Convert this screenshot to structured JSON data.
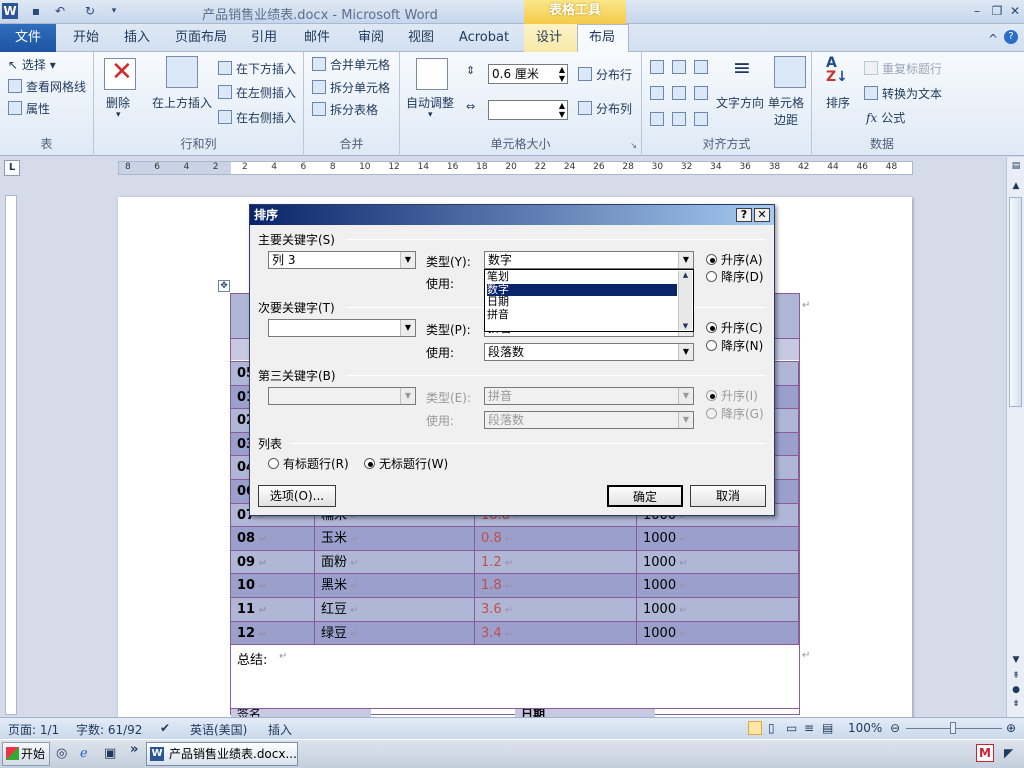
{
  "titlebar": {
    "title": "产品销售业绩表.docx - Microsoft Word",
    "context_group": "表格工具",
    "app_icon": "W"
  },
  "tabs": {
    "file": "文件",
    "items": [
      "开始",
      "插入",
      "页面布局",
      "引用",
      "邮件",
      "审阅",
      "视图",
      "Acrobat",
      "设计",
      "布局"
    ],
    "active": "布局"
  },
  "ribbon": {
    "table": {
      "label": "表",
      "select": "选择",
      "view_gridlines": "查看网格线",
      "properties": "属性"
    },
    "rows_cols": {
      "label": "行和列",
      "delete": "删除",
      "insert_above": "在上方插入",
      "insert_below": "在下方插入",
      "insert_left": "在左侧插入",
      "insert_right": "在右侧插入"
    },
    "merge": {
      "label": "合并",
      "merge_cells": "合并单元格",
      "split_cells": "拆分单元格",
      "split_table": "拆分表格"
    },
    "cell_size": {
      "label": "单元格大小",
      "autofit": "自动调整",
      "height_value": "0.6 厘米",
      "distribute_rows": "分布行",
      "distribute_cols": "分布列"
    },
    "alignment": {
      "label": "对齐方式",
      "text_direction": "文字方向",
      "cell_margins_line1": "单元格",
      "cell_margins_line2": "边距"
    },
    "data": {
      "label": "数据",
      "sort": "排序",
      "repeat_header": "重复标题行",
      "convert_text": "转换为文本",
      "formula": "公式",
      "fx": "fx"
    }
  },
  "ruler": {
    "numbers": [
      "8",
      "6",
      "4",
      "2",
      "2",
      "4",
      "6",
      "8",
      "10",
      "12",
      "14",
      "16",
      "18",
      "20",
      "22",
      "24",
      "26",
      "28",
      "30",
      "32",
      "34",
      "36",
      "38",
      "42",
      "44",
      "46",
      "48"
    ]
  },
  "document": {
    "rows": [
      {
        "id": "05",
        "name": "",
        "price": "",
        "qty": ""
      },
      {
        "id": "01",
        "name": "",
        "price": "",
        "qty": ""
      },
      {
        "id": "02",
        "name": "",
        "price": "",
        "qty": ""
      },
      {
        "id": "03",
        "name": "",
        "price": "",
        "qty": ""
      },
      {
        "id": "04",
        "name": "",
        "price": "",
        "qty": ""
      },
      {
        "id": "06",
        "name": "",
        "price": "",
        "qty": ""
      },
      {
        "id": "07",
        "name": "糯米",
        "price": "18.8",
        "qty": "1000"
      },
      {
        "id": "08",
        "name": "玉米",
        "price": "0.8",
        "qty": "1000"
      },
      {
        "id": "09",
        "name": "面粉",
        "price": "1.2",
        "qty": "1000"
      },
      {
        "id": "10",
        "name": "黑米",
        "price": "1.8",
        "qty": "1000"
      },
      {
        "id": "11",
        "name": "红豆",
        "price": "3.6",
        "qty": "1000"
      },
      {
        "id": "12",
        "name": "绿豆",
        "price": "3.4",
        "qty": "1000"
      }
    ],
    "summary_label": "总结:",
    "sign_label": "签名",
    "date_label": "日期"
  },
  "dialog": {
    "title": "排序",
    "help": "?",
    "close": "✕",
    "primary": {
      "heading": "主要关键字(S)",
      "key_value": "列 3",
      "type_label": "类型(Y):",
      "type_value": "数字",
      "use_label": "使用:",
      "asc": "升序(A)",
      "desc": "降序(D)"
    },
    "type_options": [
      "笔划",
      "数字",
      "日期",
      "拼音"
    ],
    "type_selected": "数字",
    "secondary": {
      "heading": "次要关键字(T)",
      "key_value": "",
      "type_label": "类型(P):",
      "type_value": "拼音",
      "use_label": "使用:",
      "use_value": "段落数",
      "asc": "升序(C)",
      "desc": "降序(N)"
    },
    "tertiary": {
      "heading": "第三关键字(B)",
      "key_value": "",
      "type_label": "类型(E):",
      "type_value": "拼音",
      "use_label": "使用:",
      "use_value": "段落数",
      "asc": "升序(I)",
      "desc": "降序(G)"
    },
    "list": {
      "heading": "列表",
      "has_header": "有标题行(R)",
      "no_header": "无标题行(W)"
    },
    "options_button": "选项(O)...",
    "ok_button": "确定",
    "cancel_button": "取消"
  },
  "statusbar": {
    "page": "页面: 1/1",
    "words": "字数: 61/92",
    "language": "英语(美国)",
    "insert_mode": "插入",
    "zoom": "100%"
  },
  "taskbar": {
    "start": "开始",
    "task_item": "产品销售业绩表.docx..."
  },
  "colors": {
    "accent": "#2b579a",
    "table_band_dark": "#9b9fcb",
    "table_band_light": "#b0b6d6",
    "price_red": "#c0504d"
  }
}
